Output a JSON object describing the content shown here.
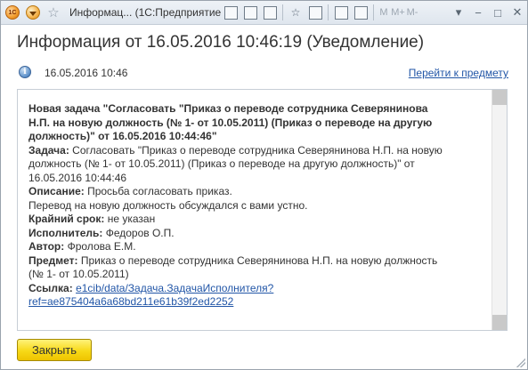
{
  "window": {
    "title": "Информац... (1С:Предприятие)",
    "toolbar_m": [
      "M",
      "M+",
      "M-"
    ]
  },
  "heading": "Информация от 16.05.2016 10:46:19 (Уведомление)",
  "info": {
    "date": "16.05.2016 10:46",
    "goto_link": "Перейти к предмету"
  },
  "message": {
    "title_lines": [
      "Новая задача \"Согласовать \"Приказ о переводе сотрудника Северянинова",
      "Н.П. на новую должность (№ 1- от 10.05.2011) (Приказ о переводе на другую",
      "должность)\" от 16.05.2016 10:44:46\""
    ],
    "task_label": "Задача:",
    "task_lines": [
      " Согласовать \"Приказ о переводе сотрудника Северянинова Н.П. на новую",
      "должность (№ 1- от 10.05.2011) (Приказ о переводе на другую должность)\" от",
      "16.05.2016 10:44:46"
    ],
    "desc_label": "Описание:",
    "desc_value": " Просьба согласовать приказ.",
    "desc_line2": "Перевод на новую должность обсуждался с вами устно.",
    "deadline_label": "Крайний срок:",
    "deadline_value": " не указан",
    "executor_label": "Исполнитель:",
    "executor_value": " Федоров О.П.",
    "author_label": "Автор:",
    "author_value": " Фролова Е.М.",
    "subject_label": "Предмет:",
    "subject_lines": [
      " Приказ о переводе сотрудника Северянинова Н.П. на новую должность",
      "(№ 1- от 10.05.2011)"
    ],
    "link_label": "Ссылка:",
    "link_lines": [
      "e1cib/data/Задача.ЗадачаИсполнителя?",
      "ref=ae875404a6a68bd211e61b39f2ed2252"
    ]
  },
  "buttons": {
    "close": "Закрыть"
  },
  "colors": {
    "link": "#2256a7",
    "button_yellow": "#f7d917"
  }
}
